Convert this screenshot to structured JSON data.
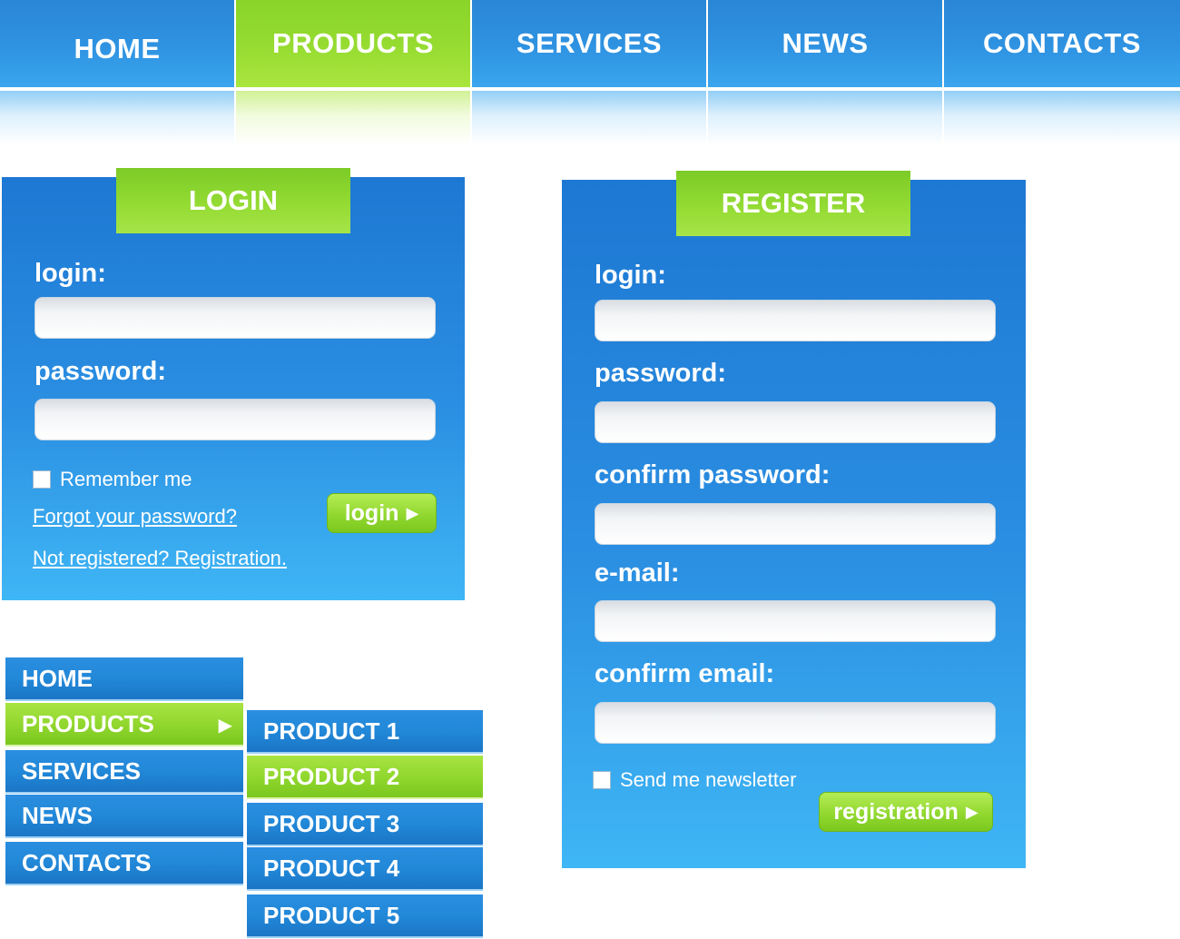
{
  "top_nav": {
    "items": [
      {
        "label": "HOME"
      },
      {
        "label": "PRODUCTS",
        "active": true
      },
      {
        "label": "SERVICES"
      },
      {
        "label": "NEWS"
      },
      {
        "label": "CONTACTS"
      }
    ]
  },
  "login_panel": {
    "title": "LOGIN",
    "login_label": "login:",
    "login_value": "",
    "password_label": "password:",
    "password_value": "",
    "remember_label": "Remember me",
    "remember_checked": false,
    "forgot_link": "Forgot your password?",
    "register_link": "Not registered? Registration.",
    "submit_label": "login",
    "submit_arrow": "▶"
  },
  "register_panel": {
    "title": "REGISTER",
    "login_label": "login:",
    "password_label": "password:",
    "confirm_password_label": "confirm password:",
    "email_label": "e-mail:",
    "confirm_email_label": "confirm email:",
    "newsletter_label": "Send me newsletter",
    "newsletter_checked": false,
    "submit_label": "registration",
    "submit_arrow": "▶"
  },
  "side_menu": {
    "items": [
      {
        "label": "HOME"
      },
      {
        "label": "PRODUCTS",
        "active": true,
        "caret": "▶"
      },
      {
        "label": "SERVICES"
      },
      {
        "label": "NEWS"
      },
      {
        "label": "CONTACTS"
      }
    ]
  },
  "submenu": {
    "items": [
      {
        "label": "PRODUCT 1"
      },
      {
        "label": "PRODUCT 2",
        "active": true
      },
      {
        "label": "PRODUCT 3"
      },
      {
        "label": "PRODUCT 4"
      },
      {
        "label": "PRODUCT 5"
      }
    ]
  },
  "colors": {
    "primary_blue": "#2288d8",
    "accent_green": "#8fd62d",
    "background": "#ffffff"
  }
}
